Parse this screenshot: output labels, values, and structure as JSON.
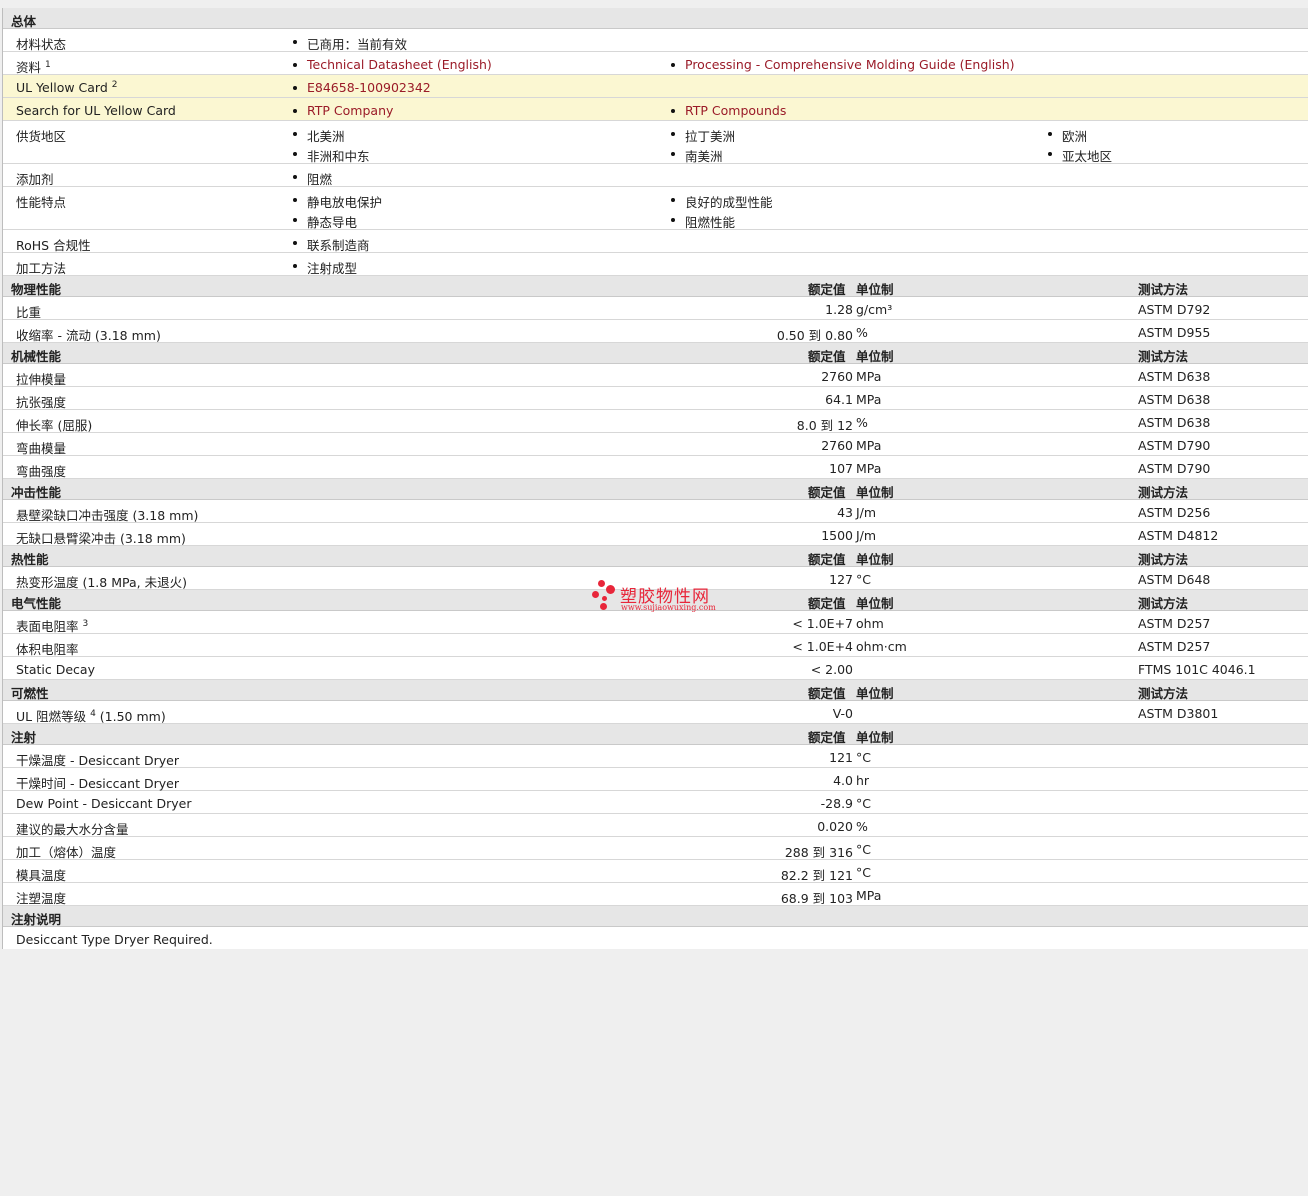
{
  "general": {
    "title": "总体",
    "material_status": {
      "label": "材料状态",
      "value": "已商用：当前有效"
    },
    "docs": {
      "label": "资料",
      "sup": "1",
      "link1": "Technical Datasheet (English)",
      "link2": "Processing - Comprehensive Molding Guide (English)"
    },
    "ul_card": {
      "label": "UL Yellow Card",
      "sup": "2",
      "link": "E84658-100902342"
    },
    "ul_search": {
      "label": "Search for UL Yellow Card",
      "link1": "RTP Company",
      "link2": "RTP Compounds"
    },
    "regions": {
      "label": "供货地区",
      "items": [
        "北美洲",
        "拉丁美洲",
        "欧洲",
        "非洲和中东",
        "南美洲",
        "亚太地区"
      ]
    },
    "additives": {
      "label": "添加剂",
      "value": "阻燃"
    },
    "features": {
      "label": "性能特点",
      "items": [
        "静电放电保护",
        "良好的成型性能",
        "静态导电",
        "阻燃性能"
      ]
    },
    "rohs": {
      "label": "RoHS 合规性",
      "value": "联系制造商"
    },
    "processing": {
      "label": "加工方法",
      "value": "注射成型"
    }
  },
  "col_headers": {
    "value": "额定值",
    "unit": "单位制",
    "method": "测试方法"
  },
  "physical": {
    "title": "物理性能",
    "rows": [
      {
        "label": "比重",
        "value": "1.28",
        "unit": "g/cm³",
        "method": "ASTM D792"
      },
      {
        "label": "收缩率 - 流动 (3.18 mm)",
        "value": "0.50 到  0.80",
        "unit": "%",
        "method": "ASTM D955"
      }
    ]
  },
  "mechanical": {
    "title": "机械性能",
    "rows": [
      {
        "label": "拉伸模量",
        "value": "2760",
        "unit": "MPa",
        "method": "ASTM D638"
      },
      {
        "label": "抗张强度",
        "value": "64.1",
        "unit": "MPa",
        "method": "ASTM D638"
      },
      {
        "label": "伸长率 (屈服)",
        "value": "8.0 到  12",
        "unit": "%",
        "method": "ASTM D638"
      },
      {
        "label": "弯曲模量",
        "value": "2760",
        "unit": "MPa",
        "method": "ASTM D790"
      },
      {
        "label": "弯曲强度",
        "value": "107",
        "unit": "MPa",
        "method": "ASTM D790"
      }
    ]
  },
  "impact": {
    "title": "冲击性能",
    "rows": [
      {
        "label": "悬壁梁缺口冲击强度 (3.18 mm)",
        "value": "43",
        "unit": "J/m",
        "method": "ASTM D256"
      },
      {
        "label": "无缺口悬臂梁冲击 (3.18 mm)",
        "value": "1500",
        "unit": "J/m",
        "method": "ASTM D4812"
      }
    ]
  },
  "thermal": {
    "title": "热性能",
    "rows": [
      {
        "label": "热变形温度 (1.8 MPa, 未退火)",
        "value": "127",
        "unit": "°C",
        "method": "ASTM D648"
      }
    ]
  },
  "electrical": {
    "title": "电气性能",
    "rows": [
      {
        "label": "表面电阻率",
        "sup": "3",
        "value": "< 1.0E+7",
        "unit": "ohm",
        "method": "ASTM D257"
      },
      {
        "label": "体积电阻率",
        "value": "< 1.0E+4",
        "unit": "ohm·cm",
        "method": "ASTM D257"
      },
      {
        "label": "Static Decay",
        "value": "< 2.00",
        "unit": "",
        "method": "FTMS 101C 4046.1"
      }
    ]
  },
  "flammability": {
    "title": "可燃性",
    "rows": [
      {
        "label": "UL 阻燃等级",
        "sup": "4",
        "label_suffix": "(1.50 mm)",
        "value": "V-0",
        "unit": "",
        "method": "ASTM D3801"
      }
    ]
  },
  "injection": {
    "title": "注射",
    "rows": [
      {
        "label": "干燥温度 - Desiccant Dryer",
        "value": "121",
        "unit": "°C"
      },
      {
        "label": "干燥时间 - Desiccant Dryer",
        "value": "4.0",
        "unit": "hr"
      },
      {
        "label": "Dew Point - Desiccant Dryer",
        "value": "-28.9",
        "unit": "°C"
      },
      {
        "label": "建议的最大水分含量",
        "value": "0.020",
        "unit": "%"
      },
      {
        "label": "加工（熔体）温度",
        "value": "288 到  316",
        "unit": "°C"
      },
      {
        "label": "模具温度",
        "value": "82.2 到  121",
        "unit": "°C"
      },
      {
        "label": "注塑温度",
        "value": "68.9 到  103",
        "unit": "MPa"
      }
    ]
  },
  "injection_notes": {
    "title": "注射说明",
    "text": "Desiccant Type Dryer Required."
  },
  "watermark": {
    "text": "塑胶物性网",
    "url": "www.sujiaowuxing.com"
  }
}
